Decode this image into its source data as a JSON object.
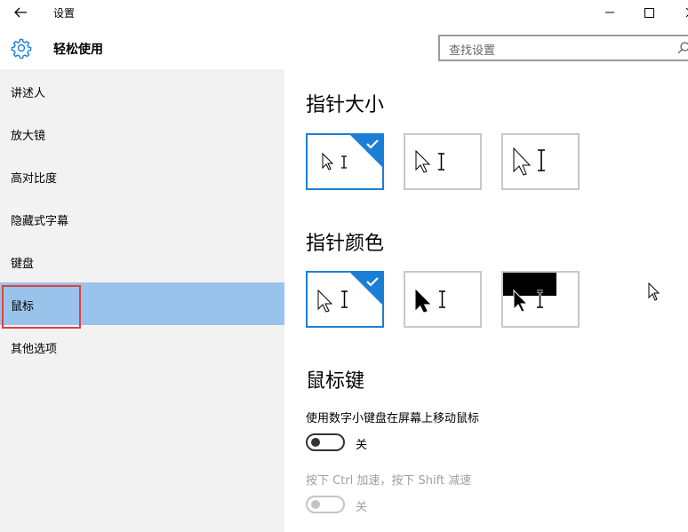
{
  "titlebar": {
    "title": "设置",
    "back_icon": "back-arrow-icon",
    "minimize_icon": "minimize-icon",
    "maximize_icon": "maximize-icon",
    "close_icon": "close-icon"
  },
  "header": {
    "title": "轻松使用",
    "icon": "gear-icon",
    "search": {
      "placeholder": "查找设置",
      "icon": "search-icon"
    }
  },
  "sidebar": {
    "items": [
      {
        "label": "讲述人"
      },
      {
        "label": "放大镜"
      },
      {
        "label": "高对比度"
      },
      {
        "label": "隐藏式字幕"
      },
      {
        "label": "键盘"
      },
      {
        "label": "鼠标",
        "selected": true
      },
      {
        "label": "其他选项"
      }
    ],
    "selected_color": "#99c3ea"
  },
  "main": {
    "pointer_size": {
      "title": "指针大小",
      "options": [
        "small",
        "medium",
        "large"
      ],
      "selected": 0
    },
    "pointer_color": {
      "title": "指针颜色",
      "options": [
        "white",
        "black",
        "inverted"
      ],
      "selected": 0
    },
    "mouse_keys": {
      "title": "鼠标键",
      "numpad_label": "使用数字小键盘在屏幕上移动鼠标",
      "numpad_toggle": {
        "state": "关",
        "on": false
      },
      "ctrl_shift_label": "按下 Ctrl 加速，按下 Shift 减速",
      "ctrl_shift_toggle": {
        "state": "关",
        "on": false,
        "disabled": true
      }
    }
  },
  "colors": {
    "accent": "#1b7fd6",
    "selection_outline": "#e0403f"
  }
}
